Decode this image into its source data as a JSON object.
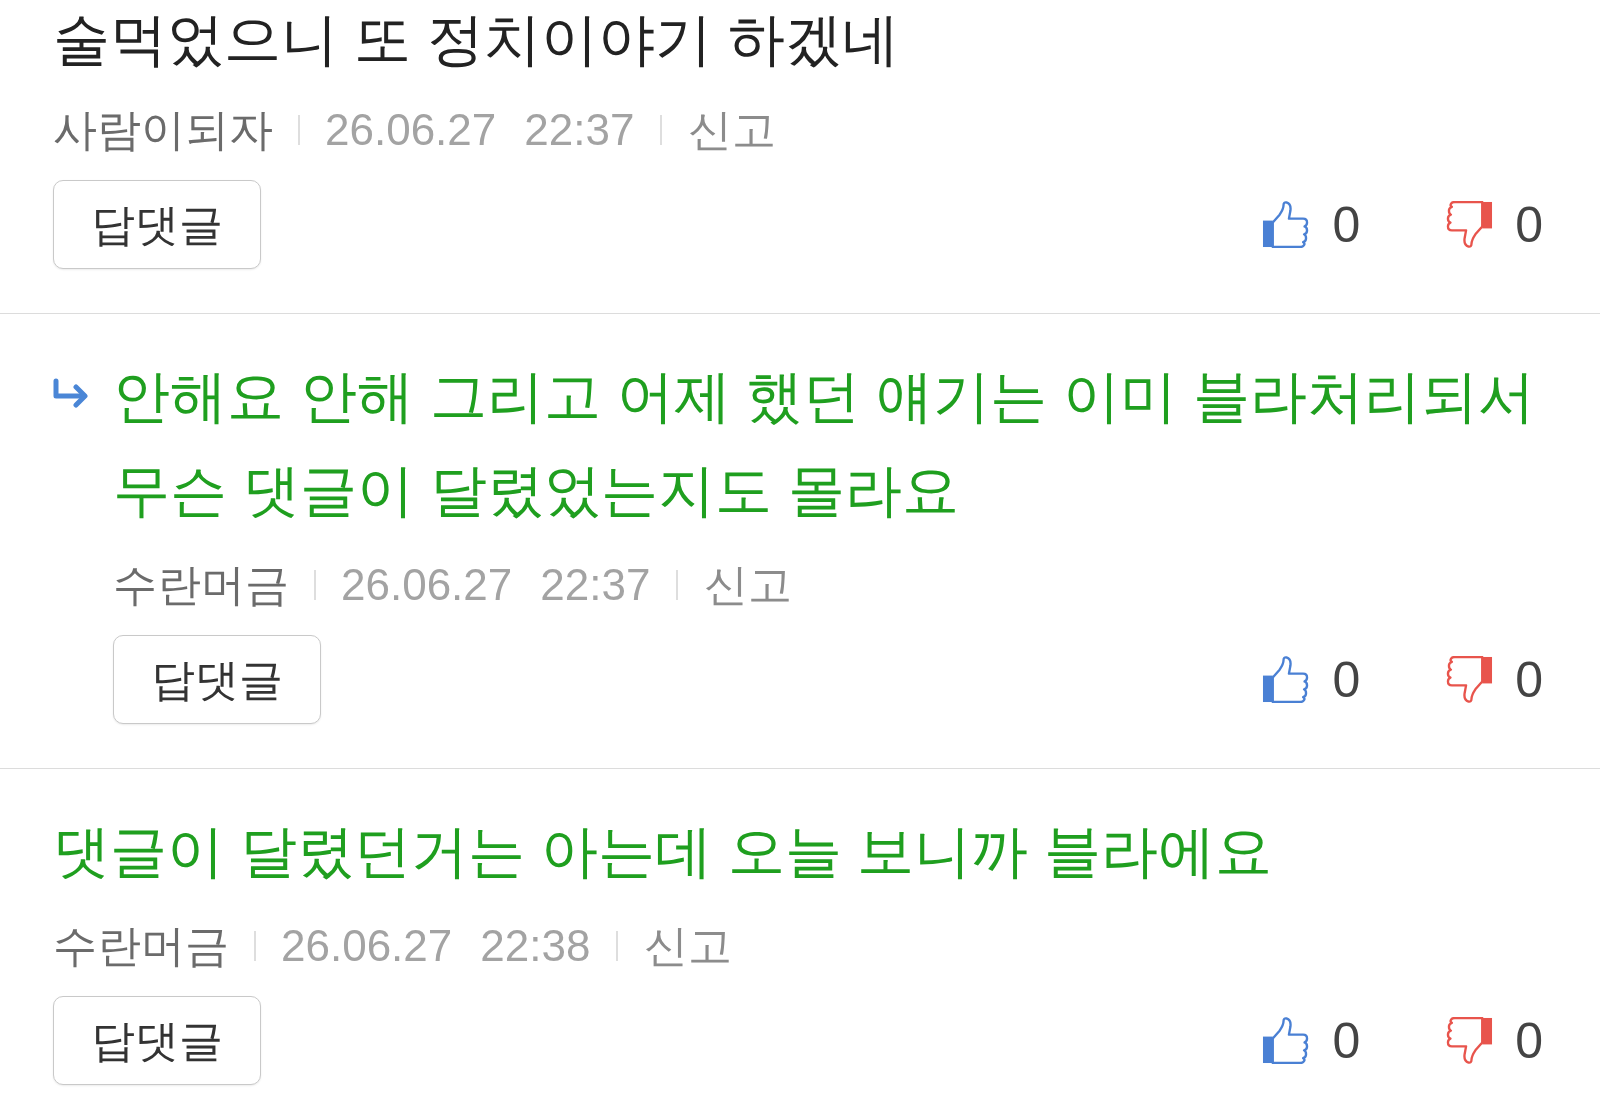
{
  "comments": [
    {
      "text": "술먹었으니 또 정치이야기 하겠네",
      "color": "#222222",
      "reply": false,
      "author": "사람이되자",
      "date": "26.06.27",
      "time": "22:37",
      "report": "신고",
      "reply_button": "답댓글",
      "likes": "0",
      "dislikes": "0"
    },
    {
      "text": "안해요 안해 그리고 어제 했던 얘기는 이미 블라처리되서 무슨 댓글이 달렸었는지도 몰라요",
      "color": "#1f9f1f",
      "reply": true,
      "author": "수란머금",
      "date": "26.06.27",
      "time": "22:37",
      "report": "신고",
      "reply_button": "답댓글",
      "likes": "0",
      "dislikes": "0"
    },
    {
      "text": "댓글이 달렸던거는 아는데 오늘 보니까 블라에요",
      "color": "#1f9f1f",
      "reply": false,
      "author": "수란머금",
      "date": "26.06.27",
      "time": "22:38",
      "report": "신고",
      "reply_button": "답댓글",
      "likes": "0",
      "dislikes": "0"
    }
  ]
}
